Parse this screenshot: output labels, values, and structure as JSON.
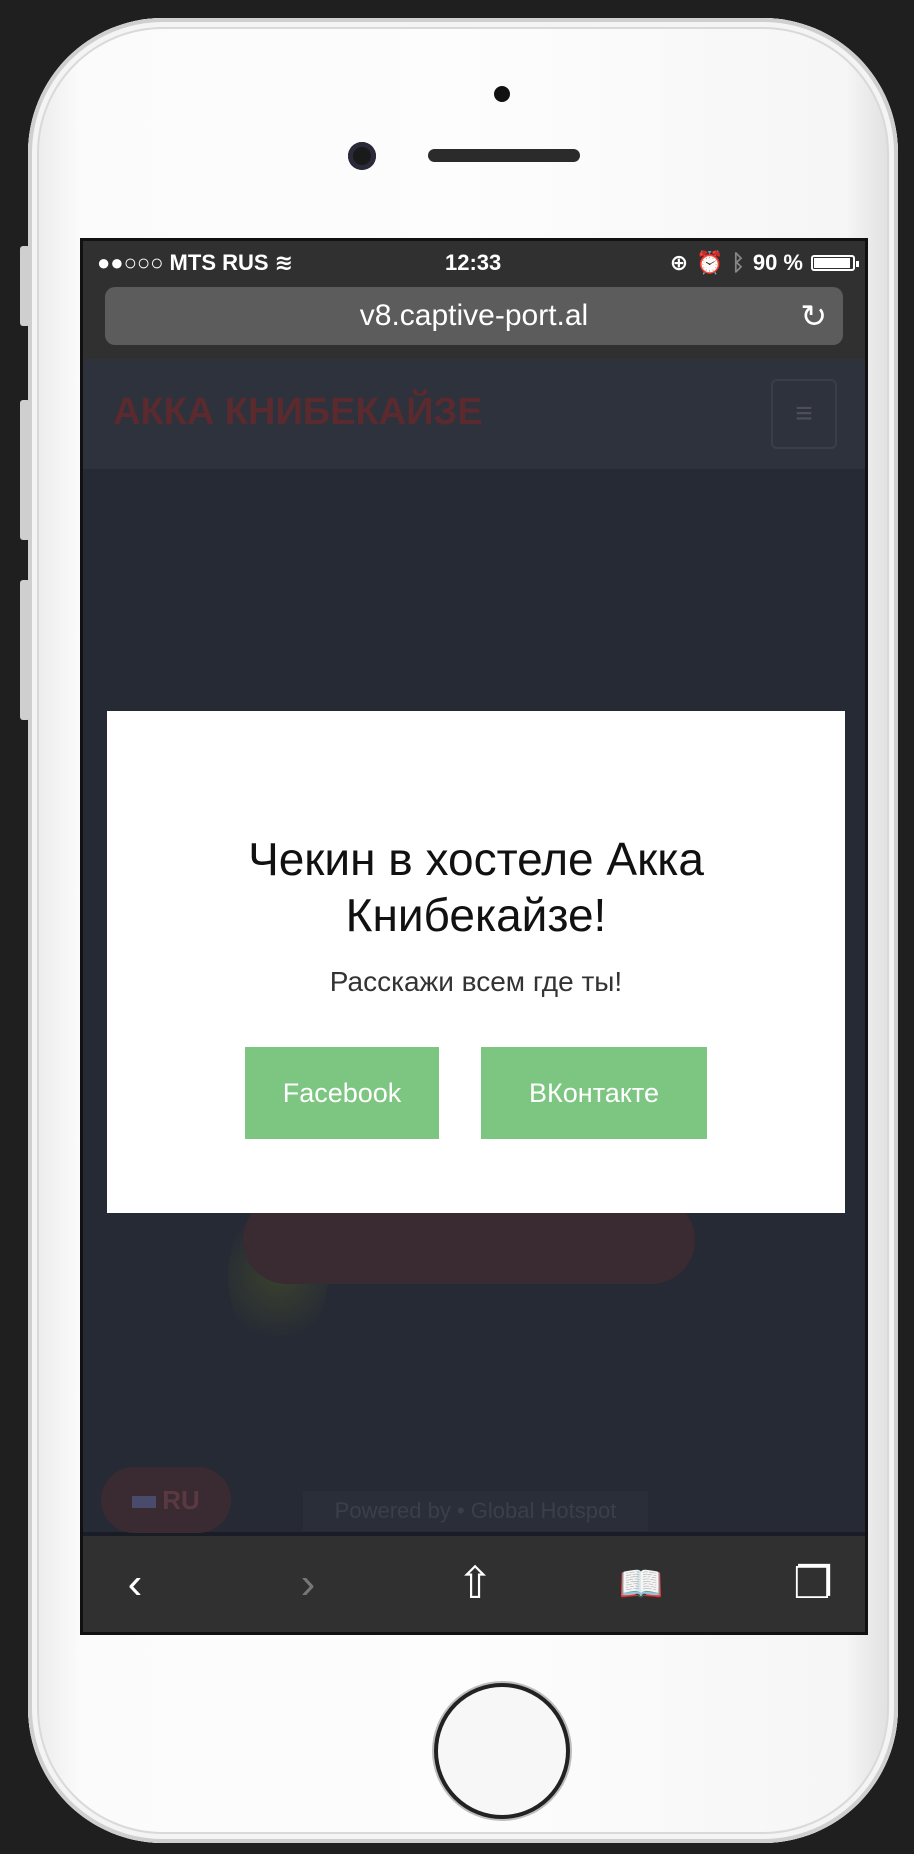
{
  "status_bar": {
    "carrier": "●●○○○ MTS RUS ",
    "wifi_icon": "≋",
    "time": "12:33",
    "battery_percent": "90 %",
    "icons": [
      "lock-rotation-icon",
      "alarm-icon",
      "bluetooth-icon",
      "battery-icon"
    ]
  },
  "browser": {
    "url": "v8.captive-port.al",
    "reload_glyph": "↻"
  },
  "site": {
    "title": "АККА КНИБЕКАЙЗЕ",
    "menu_glyph": "≡",
    "language": "RU",
    "powered_by": "Powered by  •  Global Hotspot"
  },
  "modal": {
    "title": "Чекин в хостеле Акка Книбекайзе!",
    "subtitle": "Расскажи всем где ты!",
    "buttons": [
      {
        "label": "Facebook"
      },
      {
        "label": "ВКонтакте"
      }
    ],
    "button_color": "#7dc682"
  },
  "toolbar": {
    "back": "‹",
    "forward": "›",
    "share": "⇧",
    "bookmarks": "📖",
    "tabs": "❐"
  }
}
